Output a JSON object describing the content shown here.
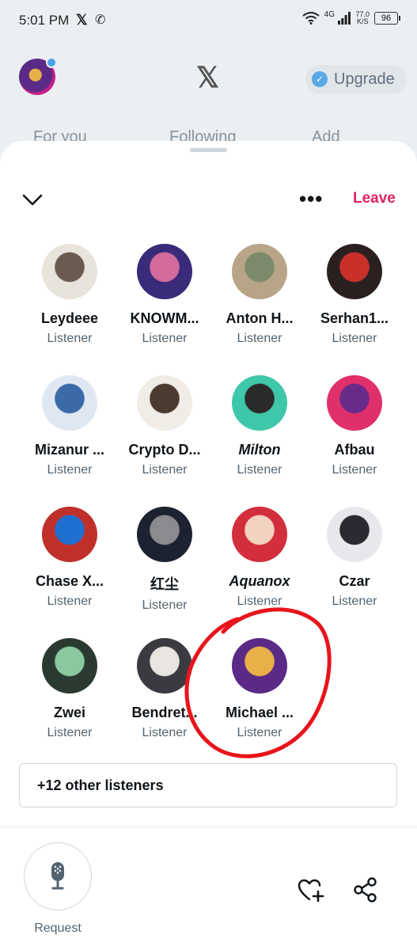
{
  "status_bar": {
    "time": "5:01 PM",
    "x_glyph": "𝕏",
    "whatsapp_glyph": "✆",
    "net_type": "4G",
    "speed_value": "77.0",
    "speed_unit": "K/S",
    "battery": "96"
  },
  "header": {
    "logo": "𝕏",
    "upgrade_label": "Upgrade",
    "check_glyph": "✓",
    "tabs": [
      "For you",
      "Following",
      "Add"
    ]
  },
  "space": {
    "leave_label": "Leave",
    "more_glyph": "•••",
    "listeners": [
      {
        "name": "Leydeee",
        "role": "Listener",
        "style": "normal",
        "colors": [
          "#e8e4dc",
          "#6b5a50"
        ]
      },
      {
        "name": "KNOWM...",
        "role": "Listener",
        "style": "normal",
        "colors": [
          "#3a2a7a",
          "#d36b9c"
        ]
      },
      {
        "name": "Anton H...",
        "role": "Listener",
        "style": "normal",
        "colors": [
          "#b8a486",
          "#7a8a6a"
        ]
      },
      {
        "name": "Serhan1...",
        "role": "Listener",
        "style": "normal",
        "colors": [
          "#2a2020",
          "#c8302a"
        ]
      },
      {
        "name": "Mizanur ...",
        "role": "Listener",
        "style": "normal",
        "colors": [
          "#dfe8f2",
          "#3c6aa8"
        ]
      },
      {
        "name": "Crypto D...",
        "role": "Listener",
        "style": "normal",
        "colors": [
          "#f2ece6",
          "#4b3a30"
        ]
      },
      {
        "name": "Milton",
        "role": "Listener",
        "style": "italic",
        "colors": [
          "#3ec7a8",
          "#2a2a2a"
        ]
      },
      {
        "name": "Afbau",
        "role": "Listener",
        "style": "normal",
        "colors": [
          "#e0306a",
          "#6a2a8a"
        ]
      },
      {
        "name": "Chase X...",
        "role": "Listener",
        "style": "normal",
        "colors": [
          "#c0302a",
          "#1f6fd0"
        ]
      },
      {
        "name": "红尘",
        "role": "Listener",
        "style": "normal",
        "colors": [
          "#1c2230",
          "#8a8a90"
        ]
      },
      {
        "name": "Aquanox",
        "role": "Listener",
        "style": "italic",
        "colors": [
          "#d22e3c",
          "#f3d2c0"
        ]
      },
      {
        "name": "Czar",
        "role": "Listener",
        "style": "normal",
        "colors": [
          "#e8e8ec",
          "#2a2a32"
        ]
      },
      {
        "name": "Zwei",
        "role": "Listener",
        "style": "normal",
        "colors": [
          "#2a3a30",
          "#8ac8a0"
        ]
      },
      {
        "name": "Bendret...",
        "role": "Listener",
        "style": "normal",
        "colors": [
          "#3a3a40",
          "#e8e4e0"
        ]
      },
      {
        "name": "Michael ...",
        "role": "Listener",
        "style": "normal",
        "colors": [
          "#5b2a86",
          "#e9b04a"
        ]
      }
    ],
    "others_label": "+12 other listeners",
    "request_label": "Request"
  },
  "colors": {
    "leave": "#e0245e",
    "annotation": "#e8141c",
    "role_text": "#536471"
  }
}
